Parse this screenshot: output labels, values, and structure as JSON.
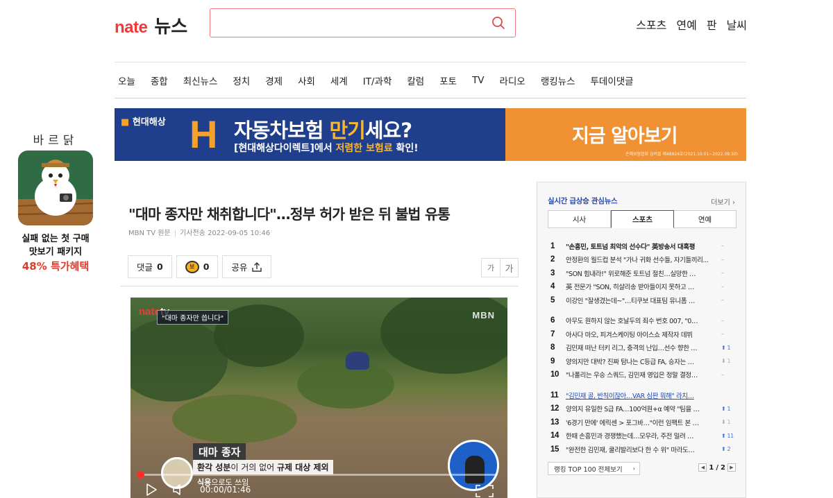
{
  "header": {
    "logo_brand": "nate",
    "logo_section": "뉴스",
    "search_placeholder": "",
    "top_links": [
      "스포츠",
      "연예",
      "판",
      "날씨"
    ]
  },
  "nav": {
    "items": [
      "오늘",
      "종합",
      "최신뉴스",
      "정치",
      "경제",
      "사회",
      "세계",
      "IT/과학",
      "칼럼",
      "포토",
      "TV",
      "라디오",
      "랭킹뉴스",
      "투데이댓글"
    ]
  },
  "left_ad": {
    "brand": "바르닭",
    "line1": "실패 없는 첫 구매",
    "line2": "맛보기 패키지",
    "line3": "48% 특가혜택"
  },
  "banner": {
    "company": "현대해상",
    "headline_pre": "자동차보험 ",
    "headline_hl": "만기",
    "headline_post": "세요?",
    "sub_pre": "[현대해상다이렉트]에서 ",
    "sub_hl": "저렴한 보험료",
    "sub_post": " 확인!",
    "cta": "지금 알아보기",
    "fineprint": "손해보험협회 심의필 제48924호(2021.10.01~2022.09.30)"
  },
  "article": {
    "title": "\"대마 종자만 채취합니다\"…정부 허가 받은 뒤 불법 유통",
    "source": "MBN TV 원문",
    "sent_label": "기사전송",
    "datetime": "2022-09-05 10:46",
    "comment_label": "댓글",
    "comment_count": "0",
    "coin_count": "0",
    "share_label": "공유",
    "font_small": "가",
    "font_large": "가"
  },
  "video": {
    "watermark_brand": "nate",
    "watermark_tv": "tv",
    "caption": "\"대마 종자만 씁니다\"",
    "channel": "MBN",
    "lower_title": "대마 종자",
    "lower_line2_a": "환각 성분",
    "lower_line2_b": "이 거의 없어 ",
    "lower_line2_c": "규제 대상 제외",
    "lower_line3_a": "식용",
    "lower_line3_b": "으로도 쓰임",
    "time": "00:00/01:46",
    "progress": 0
  },
  "ranking": {
    "title": "실시간 급상승 관심뉴스",
    "more": "더보기",
    "tabs": [
      "시사",
      "스포츠",
      "연예"
    ],
    "active_tab": 1,
    "items": [
      {
        "num": "1",
        "text": "\"손흥민, 토트넘 최악의 선수다\" 英방송서 대혹평",
        "change": "–",
        "dir": "none",
        "style": "bold"
      },
      {
        "num": "2",
        "text": "안정환의 월드컵 분석 \"가나 귀화 선수들, 자기들끼리...",
        "change": "–",
        "dir": "none",
        "style": ""
      },
      {
        "num": "3",
        "text": "\"SON 힘내라!\" 위로해준 토트넘 절친…실망한 …",
        "change": "–",
        "dir": "none",
        "style": ""
      },
      {
        "num": "4",
        "text": "英 전문가 \"SON, 히샬리송 받아들이지 못하고 …",
        "change": "–",
        "dir": "none",
        "style": ""
      },
      {
        "num": "5",
        "text": "이강인 \"잘생겼는데~\"…티쿠보 대표팀 유니폼 …",
        "change": "–",
        "dir": "none",
        "style": ""
      },
      {
        "num": "6",
        "text": "아무도 원하지 않는 호날두의 죄수 번호 007, \"0…",
        "change": "–",
        "dir": "none",
        "style": ""
      },
      {
        "num": "7",
        "text": "아사다 마오, 피겨스케이팅 아이스쇼 제작자 데뷔",
        "change": "–",
        "dir": "none",
        "style": ""
      },
      {
        "num": "8",
        "text": "김민재 떠난 터키 리그, 충격의 난입…선수 향한 …",
        "change": "1",
        "dir": "up",
        "style": ""
      },
      {
        "num": "9",
        "text": "양의지만 대박? 진짜 탐나는 C등급 FA, 승자는 …",
        "change": "1",
        "dir": "down",
        "style": ""
      },
      {
        "num": "10",
        "text": "\"나폴리는 우승 스쿼드, 김민재 영입은 정말 결정…",
        "change": "–",
        "dir": "none",
        "style": ""
      },
      {
        "num": "11",
        "text": "\"김민재 골, 반칙이잖아…VAR 심판 뭐해\" 라치…",
        "change": "",
        "dir": "none",
        "style": "link"
      },
      {
        "num": "12",
        "text": "양의지 유일한 S급 FA…100억원+α 예약 \"팀을 …",
        "change": "1",
        "dir": "up",
        "style": ""
      },
      {
        "num": "13",
        "text": "'6경기 만에' 에릭센 > 포그바…\"이런 임팩트 본 …",
        "change": "1",
        "dir": "down",
        "style": ""
      },
      {
        "num": "14",
        "text": "한때 손흥민과 경쟁했는데…모우라, 주전 밀려 …",
        "change": "11",
        "dir": "up",
        "style": ""
      },
      {
        "num": "15",
        "text": "\"완전한 김민재, 쿨리발리보다 한 수 위\" 마라도…",
        "change": "2",
        "dir": "up",
        "style": ""
      }
    ],
    "all_button": "랭킹 TOP 100 전체보기",
    "page_current": "1",
    "page_total": "2"
  }
}
